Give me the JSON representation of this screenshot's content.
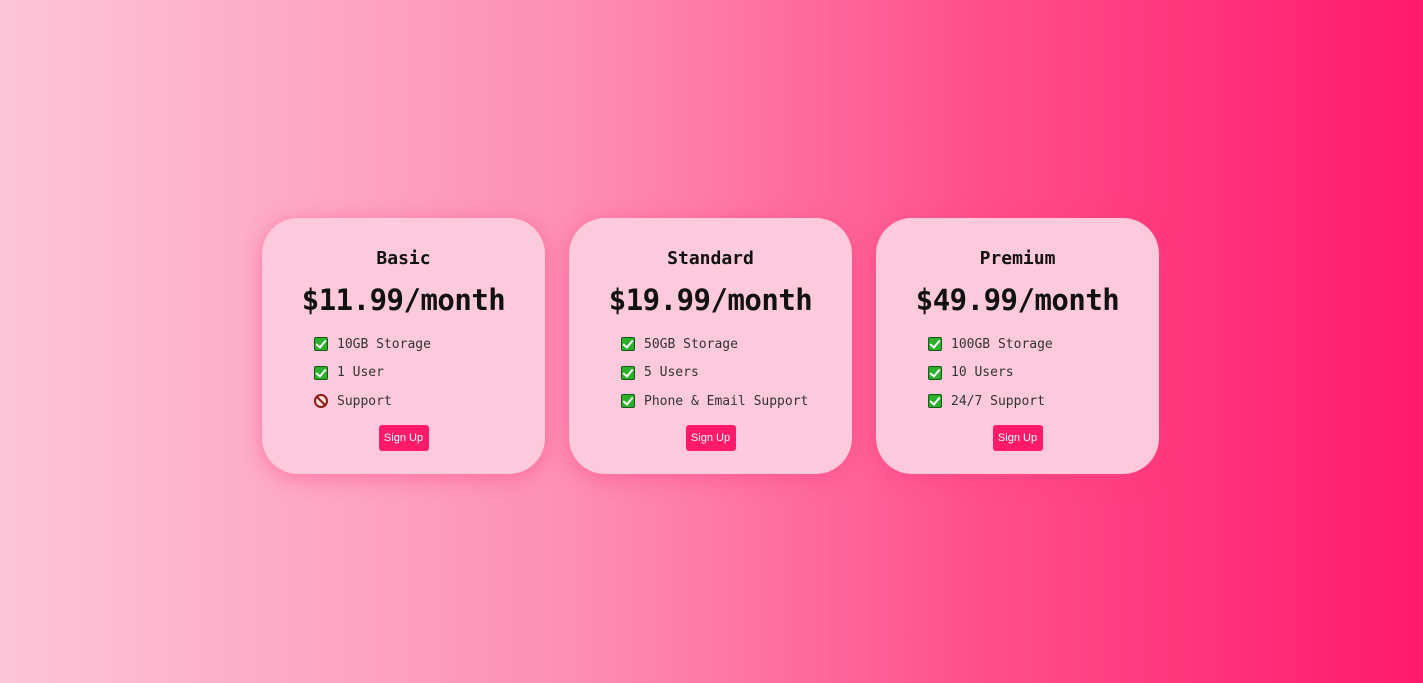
{
  "plans": [
    {
      "name": "Basic",
      "price": "$11.99/month",
      "features": [
        {
          "icon": "check-icon",
          "text": "10GB Storage",
          "included": true
        },
        {
          "icon": "check-icon",
          "text": "1 User",
          "included": true
        },
        {
          "icon": "prohibited-icon",
          "text": "Support",
          "included": false
        }
      ],
      "button_label": "Sign Up"
    },
    {
      "name": "Standard",
      "price": "$19.99/month",
      "features": [
        {
          "icon": "check-icon",
          "text": "50GB Storage",
          "included": true
        },
        {
          "icon": "check-icon",
          "text": "5 Users",
          "included": true
        },
        {
          "icon": "check-icon",
          "text": "Phone & Email Support",
          "included": true
        }
      ],
      "button_label": "Sign Up"
    },
    {
      "name": "Premium",
      "price": "$49.99/month",
      "features": [
        {
          "icon": "check-icon",
          "text": "100GB Storage",
          "included": true
        },
        {
          "icon": "check-icon",
          "text": "10 Users",
          "included": true
        },
        {
          "icon": "check-icon",
          "text": "24/7 Support",
          "included": true
        }
      ],
      "button_label": "Sign Up"
    }
  ],
  "colors": {
    "accent": "#ff1a6a",
    "card_background": "#fdc9dc",
    "check": "#2bb02b",
    "prohibited": "#8b1a1a"
  }
}
